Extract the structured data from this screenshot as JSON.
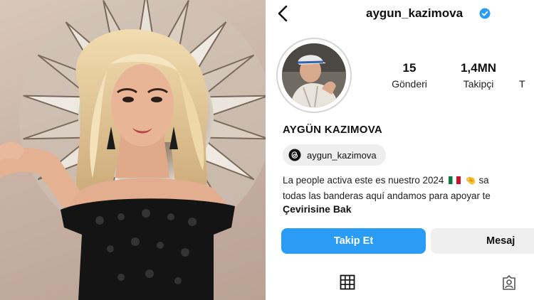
{
  "profile": {
    "username": "aygun_kazimova",
    "verified": true,
    "display_name": "AYGÜN KAZIMOVA",
    "stats": [
      {
        "value": "15",
        "label": "Gönderi"
      },
      {
        "value": "1,4MN",
        "label": "Takipçi"
      },
      {
        "value": "",
        "label": "T"
      }
    ],
    "threads_handle": "aygun_kazimova",
    "bio_line1_start": "La people activa este es nuestro 2024",
    "bio_line1_end": "sa",
    "bio_line2": "todas las banderas aquí andamos para apoyar te",
    "translate_label": "Çevirisine Bak",
    "follow_label": "Takip Et",
    "message_label": "Mesaj"
  },
  "icons": {
    "back": "chevron-left-icon",
    "verified": "verified-badge-icon",
    "threads": "threads-icon",
    "flag": "mexico-flag-icon",
    "hand": "pinching-hand-icon",
    "grid": "grid-icon",
    "tagged": "tagged-person-icon"
  },
  "colors": {
    "follow_button": "#2a9cf6",
    "message_button": "#efefef",
    "verified_badge": "#2a9cf6"
  }
}
